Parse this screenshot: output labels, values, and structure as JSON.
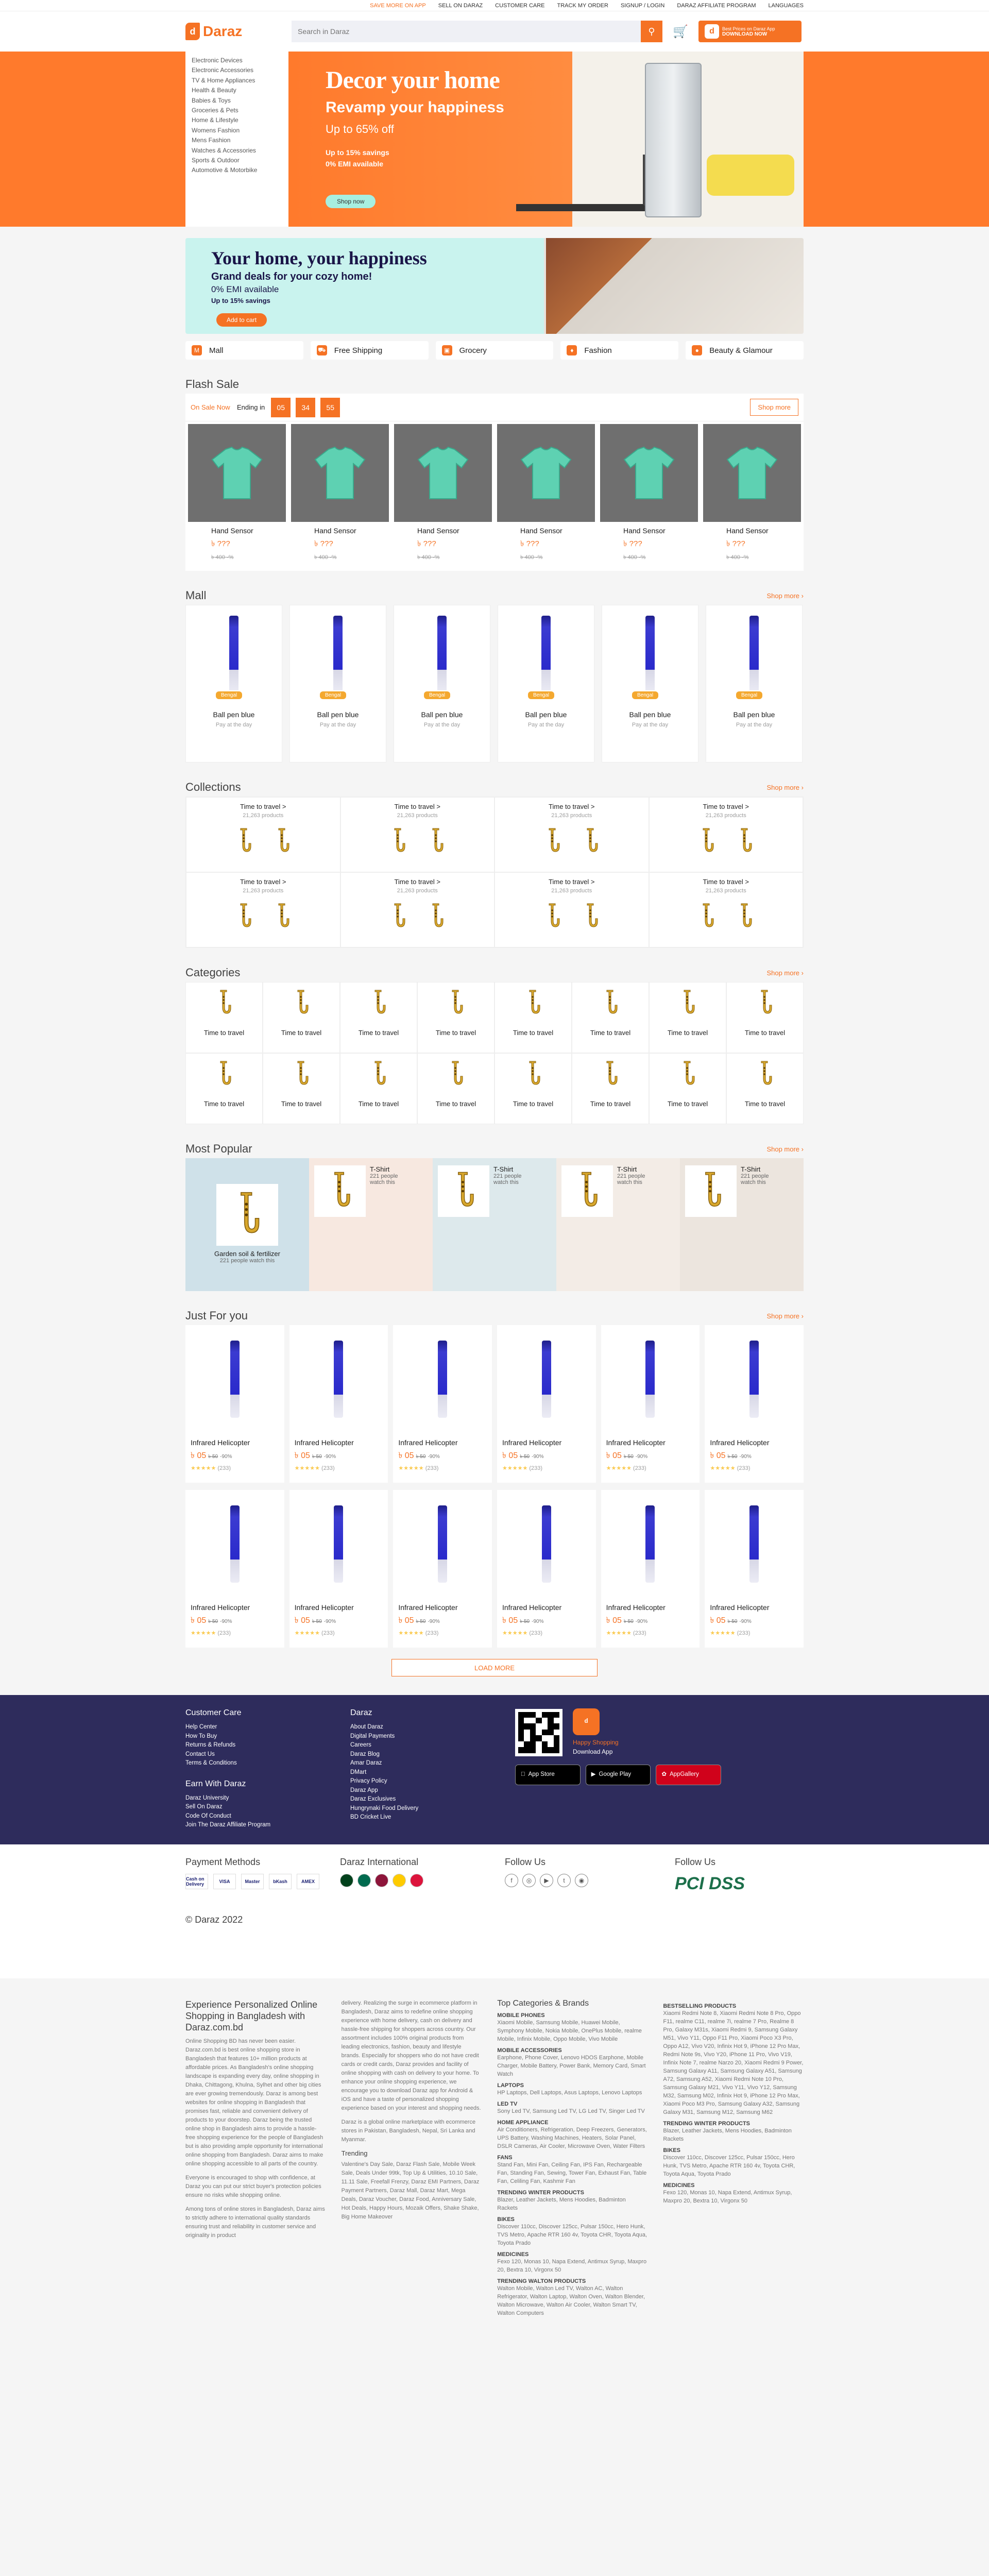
{
  "topbar": {
    "links": [
      "SAVE MORE ON APP",
      "SELL ON DARAZ",
      "CUSTOMER CARE",
      "TRACK MY ORDER",
      "SIGNUP / LOGIN",
      "DARAZ AFFILIATE PROGRAM",
      "LANGUAGES"
    ]
  },
  "header": {
    "logo": "Daraz",
    "search_placeholder": "Search in Daraz",
    "app_line1": "Best Prices on Daraz App",
    "app_line2": "DOWNLOAD NOW"
  },
  "categories_menu": [
    "Electronic Devices",
    "Electronic Accessories",
    "TV & Home Appliances",
    "Health & Beauty",
    "Babies & Toys",
    "Groceries & Pets",
    "Home & Lifestyle",
    "Womens Fashion",
    "Mens Fashion",
    "Watches & Accessories",
    "Sports & Outdoor",
    "Automotive & Motorbike"
  ],
  "hero": {
    "title": "Decor your home",
    "subtitle": "Revamp your happiness",
    "discount": "Up to 65% off",
    "savings": "Up to 15% savings",
    "emi": "0% EMI available",
    "cta": "Shop now"
  },
  "banner2": {
    "title": "Your home, your happiness",
    "subtitle": "Grand deals for your cozy home!",
    "emi": "0% EMI available",
    "savings": "Up to 15% savings",
    "cta": "Add to cart"
  },
  "pills": [
    "Mall",
    "Free Shipping",
    "Grocery",
    "Fashion",
    "Beauty & Glamour"
  ],
  "flash_sale": {
    "title": "Flash Sale",
    "on_sale": "On Sale Now",
    "ending": "Ending in",
    "timer": [
      "05",
      "34",
      "55"
    ],
    "shop_more": "Shop more",
    "products": [
      {
        "title": "Hand Sensor",
        "price": "৳ ???",
        "old": "৳ 400  -%"
      },
      {
        "title": "Hand Sensor",
        "price": "৳ ???",
        "old": "৳ 400  -%"
      },
      {
        "title": "Hand Sensor",
        "price": "৳ ???",
        "old": "৳ 400  -%"
      },
      {
        "title": "Hand Sensor",
        "price": "৳ ???",
        "old": "৳ 400  -%"
      },
      {
        "title": "Hand Sensor",
        "price": "৳ ???",
        "old": "৳ 400  -%"
      },
      {
        "title": "Hand Sensor",
        "price": "৳ ???",
        "old": "৳ 400  -%"
      }
    ]
  },
  "mall": {
    "title": "Mall",
    "shop_more": "Shop more",
    "badge": "Bengal",
    "items": [
      {
        "title": "Ball pen blue",
        "sub": "Pay at the day"
      },
      {
        "title": "Ball pen blue",
        "sub": "Pay at the day"
      },
      {
        "title": "Ball pen blue",
        "sub": "Pay at the day"
      },
      {
        "title": "Ball pen blue",
        "sub": "Pay at the day"
      },
      {
        "title": "Ball pen blue",
        "sub": "Pay at the day"
      },
      {
        "title": "Ball pen blue",
        "sub": "Pay at the day"
      }
    ]
  },
  "collections": {
    "title": "Collections",
    "shop_more": "Shop more",
    "items": [
      {
        "title": "Time to travel >",
        "sub": "21,263 products"
      },
      {
        "title": "Time to travel >",
        "sub": "21,263 products"
      },
      {
        "title": "Time to travel >",
        "sub": "21,263 products"
      },
      {
        "title": "Time to travel >",
        "sub": "21,263 products"
      },
      {
        "title": "Time to travel >",
        "sub": "21,263 products"
      },
      {
        "title": "Time to travel >",
        "sub": "21,263 products"
      },
      {
        "title": "Time to travel >",
        "sub": "21,263 products"
      },
      {
        "title": "Time to travel >",
        "sub": "21,263 products"
      }
    ]
  },
  "categories": {
    "title": "Categories",
    "shop_more": "Shop more",
    "items": [
      "Time to travel",
      "Time to travel",
      "Time to travel",
      "Time to travel",
      "Time to travel",
      "Time to travel",
      "Time to travel",
      "Time to travel",
      "Time to travel",
      "Time to travel",
      "Time to travel",
      "Time to travel",
      "Time to travel",
      "Time to travel",
      "Time to travel",
      "Time to travel"
    ]
  },
  "most_popular": {
    "title": "Most Popular",
    "shop_more": "Shop more",
    "big": {
      "title": "Garden soil & fertilizer",
      "sub": "221 people watch this"
    },
    "small": [
      {
        "title": "T-Shirt",
        "sub": "221 people watch this"
      },
      {
        "title": "T-Shirt",
        "sub": "221 people watch this"
      },
      {
        "title": "T-Shirt",
        "sub": "221 people watch this"
      },
      {
        "title": "T-Shirt",
        "sub": "221 people watch this"
      }
    ],
    "colors": [
      "#f7e8e0",
      "#dde9ec",
      "#f3ece6",
      "#ece5de"
    ]
  },
  "just_for_you": {
    "title": "Just For you",
    "shop_more": "Shop more",
    "items": [
      {
        "title": "Infrared Helicopter",
        "price": "৳ 05",
        "old": "৳ 50",
        "disc": "-90%",
        "reviews": "(233)"
      },
      {
        "title": "Infrared Helicopter",
        "price": "৳ 05",
        "old": "৳ 50",
        "disc": "-90%",
        "reviews": "(233)"
      },
      {
        "title": "Infrared Helicopter",
        "price": "৳ 05",
        "old": "৳ 50",
        "disc": "-90%",
        "reviews": "(233)"
      },
      {
        "title": "Infrared Helicopter",
        "price": "৳ 05",
        "old": "৳ 50",
        "disc": "-90%",
        "reviews": "(233)"
      },
      {
        "title": "Infrared Helicopter",
        "price": "৳ 05",
        "old": "৳ 50",
        "disc": "-90%",
        "reviews": "(233)"
      },
      {
        "title": "Infrared Helicopter",
        "price": "৳ 05",
        "old": "৳ 50",
        "disc": "-90%",
        "reviews": "(233)"
      },
      {
        "title": "Infrared Helicopter",
        "price": "৳ 05",
        "old": "৳ 50",
        "disc": "-90%",
        "reviews": "(233)"
      },
      {
        "title": "Infrared Helicopter",
        "price": "৳ 05",
        "old": "৳ 50",
        "disc": "-90%",
        "reviews": "(233)"
      },
      {
        "title": "Infrared Helicopter",
        "price": "৳ 05",
        "old": "৳ 50",
        "disc": "-90%",
        "reviews": "(233)"
      },
      {
        "title": "Infrared Helicopter",
        "price": "৳ 05",
        "old": "৳ 50",
        "disc": "-90%",
        "reviews": "(233)"
      },
      {
        "title": "Infrared Helicopter",
        "price": "৳ 05",
        "old": "৳ 50",
        "disc": "-90%",
        "reviews": "(233)"
      },
      {
        "title": "Infrared Helicopter",
        "price": "৳ 05",
        "old": "৳ 50",
        "disc": "-90%",
        "reviews": "(233)"
      }
    ],
    "load_more": "LOAD MORE"
  },
  "footer": {
    "customer_care_title": "Customer Care",
    "customer_care": [
      "Help Center",
      "How To Buy",
      "Returns & Refunds",
      "Contact Us",
      "Terms & Conditions"
    ],
    "earn_title": "Earn With Daraz",
    "earn": [
      "Daraz University",
      "Sell On Daraz",
      "Code Of Conduct",
      "Join The Daraz Affiliate Program"
    ],
    "daraz_title": "Daraz",
    "daraz": [
      "About Daraz",
      "Digital Payments",
      "Careers",
      "Daraz Blog",
      "Amar Daraz",
      "DMart",
      "Privacy Policy",
      "Daraz App",
      "Daraz Exclusives",
      "Hungrynaki Food Delivery",
      "BD Cricket Live"
    ],
    "app_title1": "Happy Shopping",
    "app_title2": "Download App",
    "stores": [
      "App Store",
      "Google Play",
      "AppGallery"
    ],
    "payment_title": "Payment Methods",
    "payments": [
      "Cash on Delivery",
      "VISA",
      "Master",
      "bKash",
      "AMEX"
    ],
    "intl_title": "Daraz International",
    "follow_title": "Follow Us",
    "social": [
      "f",
      "◎",
      "▶",
      "t",
      "◉"
    ],
    "verified_title": "Follow Us",
    "pci": "PCI DSS",
    "copyright": "© Daraz 2022"
  },
  "seo": {
    "heading": "Experience Personalized Online Shopping in Bangladesh with Daraz.com.bd",
    "p1": "Online Shopping BD has never been easier. Daraz.com.bd is best online shopping store in Bangladesh that features 10+ million products at affordable prices. As Bangladesh's online shopping landscape is expanding every day, online shopping in Dhaka, Chittagong, Khulna, Sylhet and other big cities are ever growing tremendously. Daraz is among best websites for online shopping in Bangladesh that promises fast, reliable and convenient delivery of products to your doorstep. Daraz being the trusted online shop in Bangladesh aims to provide a hassle-free shopping experience for the people of Bangladesh but is also providing ample opportunity for international online shopping from Bangladesh. Daraz aims to make online shopping accessible to all parts of the country.",
    "p2": "Everyone is encouraged to shop with confidence, at Daraz you can put our strict buyer's protection policies ensure no risks while shopping online.",
    "p3": "Among tons of online stores in Bangladesh, Daraz aims to strictly adhere to international quality standards ensuring trust and reliability in customer service and originality in product",
    "p4": "delivery. Realizing the surge in ecommerce platform in Bangladesh, Daraz aims to redefine online shopping experience with home delivery, cash on delivery and hassle-free shipping for shoppers across country. Our assortment includes 100% original products from leading electronics, fashion, beauty and lifestyle brands. Especially for shoppers who do not have credit cards or credit cards, Daraz provides and facility of online shopping with cash on delivery to your home. To enhance your online shopping experience, we encourage you to download Daraz app for Android & iOS and have a taste of personalized shopping experience based on your interest and shopping needs.",
    "p5": "Daraz is a global online marketplace with ecommerce stores in Pakistan, Bangladesh, Nepal, Sri Lanka and Myanmar.",
    "trending_title": "Trending",
    "trending": "Valentine's Day Sale, Daraz Flash Sale, Mobile Week Sale, Deals Under 99tk, Top Up & Utilities, 10.10 Sale, 11.11 Sale, Freefall Frenzy, Daraz EMI Partners, Daraz Payment Partners, Daraz Mall, Daraz Mart, Mega Deals, Daraz Voucher, Daraz Food, Anniversary Sale, Hot Deals, Happy Hours, Mozaik Offers, Shake Shake, Big Home Makeover",
    "brands_title": "Top Categories & Brands",
    "brands": [
      {
        "h": "MOBILE PHONES",
        "p": "Xiaomi Mobile, Samsung Mobile, Huawei Mobile, Symphony Mobile, Nokia Mobile, OnePlus Mobile, realme Mobile, Infinix Mobile, Oppo Mobile, Vivo Mobile"
      },
      {
        "h": "MOBILE ACCESSORIES",
        "p": "Earphone, Phone Cover, Lenovo HDOS Earphone, Mobile Charger, Mobile Battery, Power Bank, Memory Card, Smart Watch"
      },
      {
        "h": "LAPTOPS",
        "p": "HP Laptops, Dell Laptops, Asus Laptops, Lenovo Laptops"
      },
      {
        "h": "LED TV",
        "p": "Sony Led TV, Samsung Led TV, LG Led TV, Singer Led TV"
      },
      {
        "h": "HOME APPLIANCE",
        "p": "Air Conditioners, Refrigeration, Deep Freezers, Generators, UPS Battery, Washing Machines, Heaters, Solar Panel, DSLR Cameras, Air Cooler, Microwave Oven, Water Filters"
      },
      {
        "h": "FANS",
        "p": "Stand Fan, Mini Fan, Ceiling Fan, IPS Fan, Rechargeable Fan, Standing Fan, Sewing, Tower Fan, Exhaust Fan, Table Fan, Celiling Fan, Kashmir Fan"
      },
      {
        "h": "TRENDING WINTER PRODUCTS",
        "p": "Blazer, Leather Jackets, Mens Hoodies, Badminton Rackets"
      },
      {
        "h": "BIKES",
        "p": "Discover 110cc, Discover 125cc, Pulsar 150cc, Hero Hunk, TVS Metro, Apache RTR 160 4v, Toyota CHR, Toyota Aqua, Toyota Prado"
      },
      {
        "h": "MEDICINES",
        "p": "Fexo 120, Monas 10, Napa Extend, Antimux Syrup, Maxpro 20, Bextra 10, Virgonx 50"
      },
      {
        "h": "TRENDING WALTON PRODUCTS",
        "p": "Walton Mobile, Walton Led TV, Walton AC, Walton Refrigerator, Walton Laptop, Walton Oven, Walton Blender, Walton Microwave, Walton Air Cooler, Walton Smart TV, Walton Computers"
      }
    ],
    "best_title": "BESTSELLING PRODUCTS",
    "best": "Xiaomi Redmi Note 8, Xiaomi Redmi Note 8 Pro, Oppo F11, realme C11, realme 7i, realme 7 Pro, Realme 8 Pro, Galaxy M31s, Xiaomi Redmi 9, Samsung Galaxy M51, Vivo Y11, Oppo F11 Pro, Xiaomi Poco X3 Pro, Oppo A12, Vivo V20, Infinix Hot 9, iPhone 12 Pro Max, Redmi Note 9s, Vivo Y20, iPhone 11 Pro, Vivo V19, Infinix Note 7, realme Narzo 20, Xiaomi Redmi 9 Power, Samsung Galaxy A11, Samsung Galaxy A51, Samsung A72, Samsung A52, Xiaomi Redmi Note 10 Pro, Samsung Galaxy M21, Vivo Y11, Vivo Y12, Samsung M32, Samsung M02, Infinix Hot 9, iPhone 12 Pro Max, Xiaomi Poco M3 Pro, Samsung Galaxy A32, Samsung Galaxy M31, Samsung M12, Samsung M62",
    "bikes_title": "BIKES",
    "bikes": "Discover 110cc, Discover 125cc, Pulsar 150cc, Hero Hunk, TVS Metro, Apache RTR 160 4v, Toyota CHR, Toyota Aqua, Toyota Prado",
    "med_title": "MEDICINES",
    "med": "Fexo 120, Monas 10, Napa Extend, Antimux Syrup, Maxpro 20, Bextra 10, Virgonx 50",
    "winter_title": "TRENDING WINTER PRODUCTS",
    "winter": "Blazer, Leather Jackets, Mens Hoodies, Badminton Rackets"
  }
}
